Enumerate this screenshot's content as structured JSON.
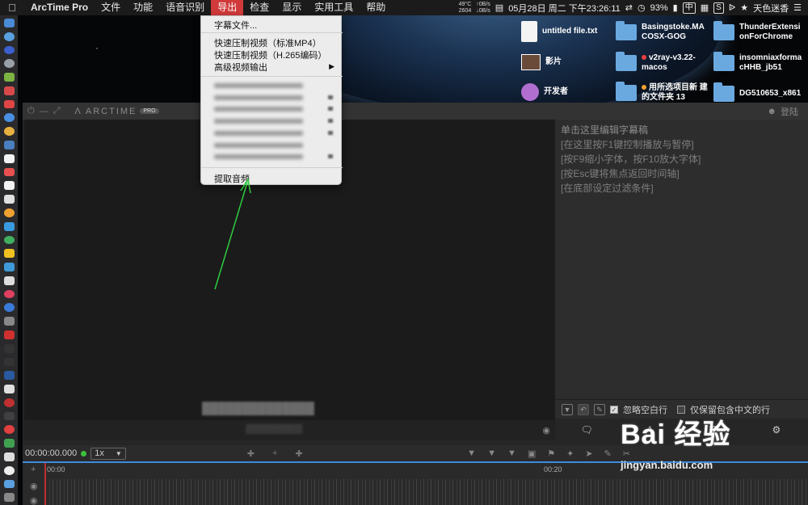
{
  "menubar": {
    "app_name": "ArcTime Pro",
    "items": [
      "文件",
      "功能",
      "语音识别",
      "导出",
      "检查",
      "显示",
      "实用工具",
      "帮助"
    ],
    "active_item": "导出",
    "status": {
      "temp": "49°C",
      "fan": "2604",
      "net_up": "↑0B/s",
      "net_down": "↓0B/s",
      "datetime": "05月28日 周二 下午23:26:11",
      "battery": "93%",
      "input_method": "中",
      "user": "天色迷香"
    }
  },
  "desktop": {
    "items": [
      {
        "label": "untitled file.txt",
        "kind": "file"
      },
      {
        "label": "Basingstoke.MA COSX-GOG",
        "kind": "folder"
      },
      {
        "label": "ThunderExtensi onForChrome",
        "kind": "folder"
      },
      {
        "label": "影片",
        "kind": "thumb"
      },
      {
        "label": "v2ray-v3.22- macos",
        "kind": "folder",
        "tag": "red"
      },
      {
        "label": "insomniaxforma cHHB_jb51",
        "kind": "folder"
      },
      {
        "label": "开发者",
        "kind": "thumb2"
      },
      {
        "label": "用所选项目新 建的文件夹 13",
        "kind": "folder",
        "tag": "orange"
      },
      {
        "label": "DG510653_x861",
        "kind": "folder"
      }
    ]
  },
  "export_menu": {
    "items": [
      {
        "label": "字幕文件..."
      },
      {
        "label": "快速压制视频（标准MP4）"
      },
      {
        "label": "快速压制视频（H.265编码）"
      },
      {
        "label": "高级视频输出",
        "submenu": true
      },
      {
        "label": "提取音频"
      }
    ]
  },
  "app": {
    "brand": "ARCTIME",
    "brand_badge": "PRO",
    "login": "登陆",
    "subtitle_hints": [
      "单击这里编辑字幕稿",
      "[在这里按F1键控制播放与暂停]",
      "[按F9缩小字体，按F10放大字体]",
      "[按Esc键将焦点返回时间轴]",
      "[在底部设定过滤条件]"
    ],
    "filter": {
      "ignore_blank": "忽略空白行",
      "ignore_blank_checked": true,
      "chinese_only": "仅保留包含中文的行",
      "chinese_only_checked": false
    },
    "transport": {
      "timecode": "00:00:00.000",
      "speed": "1x"
    },
    "ruler": {
      "start": "00:00",
      "mark": "00:20"
    }
  },
  "watermark": {
    "logo": "Bai 经验",
    "url": "jingyan.baidu.com"
  },
  "colors": {
    "active_menu": "#d13a3a",
    "arrow": "#2ecc40",
    "timeline_accent": "#3e8bd9"
  }
}
